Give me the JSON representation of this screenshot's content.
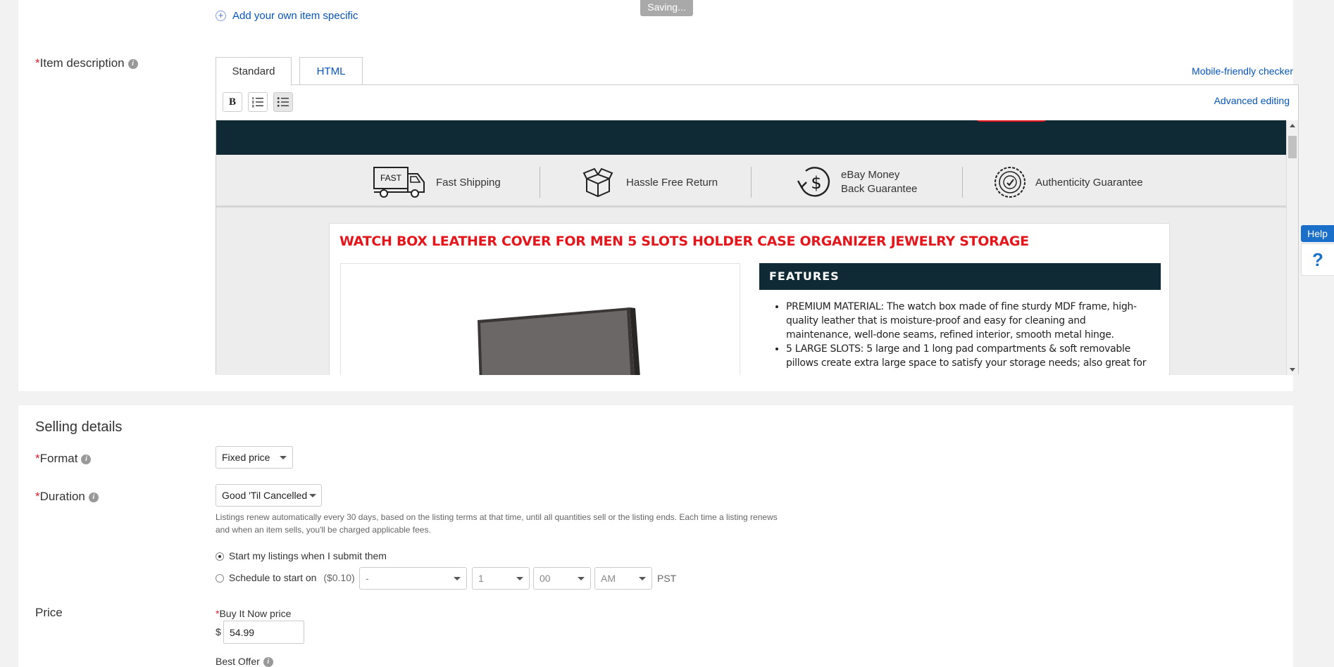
{
  "status": {
    "saving": "Saving..."
  },
  "item_specifics": {
    "add_own": "Add your own item specific"
  },
  "item_description": {
    "required_mark": "*",
    "label": "Item description",
    "tabs": [
      {
        "label": "Standard",
        "active": true
      },
      {
        "label": "HTML",
        "active": false
      }
    ],
    "mobile_checker": "Mobile-friendly checker",
    "advanced_editing": "Advanced editing",
    "toolbar": {
      "bold": "B"
    },
    "preview": {
      "guarantees": [
        {
          "icon": "fast-shipping-truck-icon",
          "badge": "FAST",
          "label": "Fast Shipping"
        },
        {
          "icon": "hassle-free-return-box-icon",
          "label": "Hassle Free Return"
        },
        {
          "icon": "money-back-icon",
          "line1": "eBay Money",
          "line2": "Back Guarantee"
        },
        {
          "icon": "authenticity-seal-icon",
          "label": "Authenticity Guarantee"
        }
      ],
      "product_title": "WATCH BOX LEATHER COVER FOR MEN 5 SLOTS HOLDER CASE ORGANIZER JEWELRY STORAGE",
      "features_heading": "FEATURES",
      "features": [
        "PREMIUM MATERIAL: The watch box made of fine sturdy MDF frame, high-quality leather that is moisture-proof and easy for cleaning and maintenance, well-done seams, refined interior, smooth metal hinge.",
        "5 LARGE SLOTS: 5 large and 1 long pad compartments & soft removable pillows create extra large space to satisfy your storage needs; also great for"
      ]
    }
  },
  "selling_details": {
    "heading": "Selling details",
    "format": {
      "label": "Format",
      "value": "Fixed price"
    },
    "duration": {
      "label": "Duration",
      "value": "Good 'Til Cancelled",
      "note": "Listings renew automatically every 30 days, based on the listing terms at that time, until all quantities sell or the listing ends. Each time a listing renews and when an item sells, you'll be charged applicable fees."
    },
    "start": {
      "option_now": "Start my listings when I submit them",
      "option_schedule": "Schedule to start on",
      "schedule_fee": "($0.10)",
      "date": "-",
      "hour": "1",
      "minute": "00",
      "ampm": "AM",
      "timezone": "PST"
    },
    "price": {
      "label": "Price",
      "bin_label": "Buy It Now price",
      "currency": "$",
      "value": "54.99",
      "best_offer": "Best Offer"
    }
  },
  "help": {
    "label": "Help",
    "question": "?"
  }
}
